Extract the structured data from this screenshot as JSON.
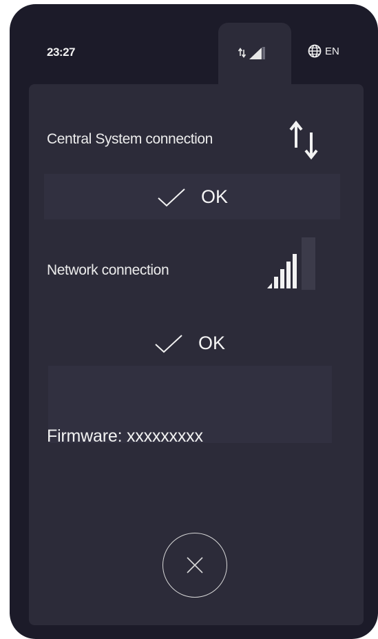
{
  "status_bar": {
    "time": "23:27",
    "connection_icon": "data-transfer-signal-icon",
    "language_icon": "globe-icon",
    "language": "EN"
  },
  "central_system": {
    "label": "Central System connection",
    "icon": "up-down-arrows-icon",
    "status": "OK",
    "status_icon": "checkmark-icon"
  },
  "network": {
    "label": "Network connection",
    "icon": "signal-bars-icon",
    "signal_strength_bars": 4,
    "signal_total_bars": 5,
    "status": "OK",
    "status_icon": "checkmark-icon"
  },
  "firmware": {
    "text": "Firmware: xxxxxxxxx"
  },
  "close_button": {
    "icon": "close-icon"
  },
  "colors": {
    "device_bg": "#1c1b29",
    "panel_bg": "#2c2b39",
    "text": "#f2f2f2"
  }
}
